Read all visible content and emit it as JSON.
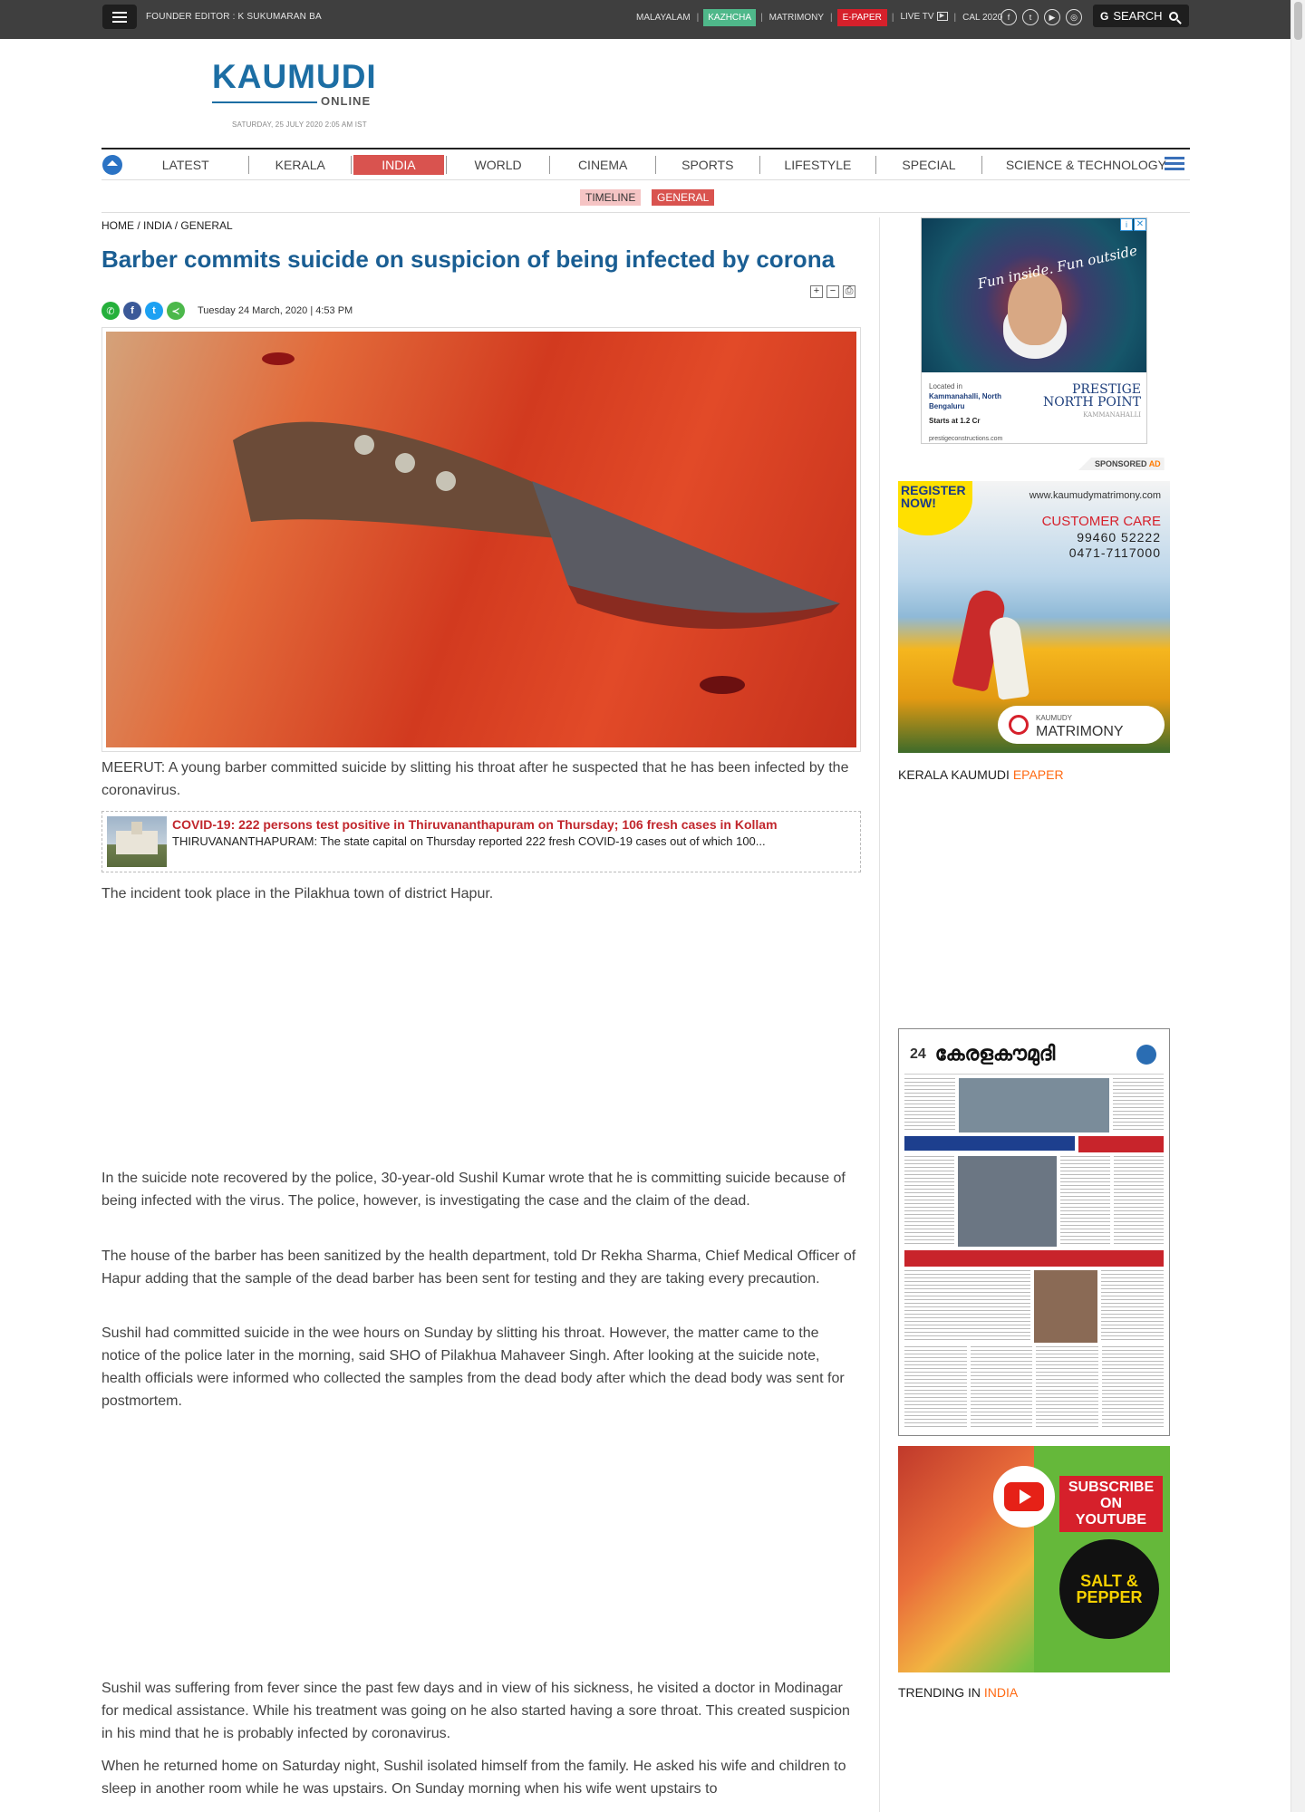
{
  "topbar": {
    "founder": "FOUNDER EDITOR : K SUKUMARAN BA",
    "links": [
      "MALAYALAM",
      "KAZHCHA",
      "MATRIMONY",
      "E-PAPER",
      "LIVE TV",
      "CAL 2020"
    ],
    "search_label": "SEARCH"
  },
  "logo": {
    "main": "KAUMUDI",
    "sub": "ONLINE"
  },
  "dateline": "SATURDAY, 25 JULY 2020 2:05 AM IST",
  "nav": {
    "items": [
      "LATEST",
      "KERALA",
      "INDIA",
      "WORLD",
      "CINEMA",
      "SPORTS",
      "LIFESTYLE",
      "SPECIAL",
      "SCIENCE & TECHNOLOGY"
    ],
    "active": "INDIA",
    "sub": [
      "TIMELINE",
      "GENERAL"
    ]
  },
  "article": {
    "breadcrumb": [
      "HOME",
      "INDIA",
      "GENERAL"
    ],
    "title": "Barber commits suicide on suspicion of being infected by corona",
    "date": "Tuesday 24 March, 2020 | 4:53 PM",
    "paragraphs": [
      "MEERUT: A young barber committed suicide by slitting his throat after he suspected that he has been infected by the coronavirus.",
      "The incident took place in the Pilakhua town of district Hapur.",
      "In the suicide note recovered by the police, 30-year-old Sushil Kumar wrote that he is committing suicide because of being infected with the virus. The police, however, is investigating the case and the claim of the dead.",
      "The house of the barber has been sanitized by the health department, told Dr Rekha Sharma, Chief Medical Officer of Hapur adding that the sample of the dead barber has been sent for testing and they are taking every precaution.",
      "Sushil had committed suicide in the wee hours on Sunday by slitting his throat. However, the matter came to the notice of the police later in the morning, said SHO of Pilakhua Mahaveer Singh. After looking at the suicide note, health officials were informed who collected the samples from the dead body after which the dead body was sent for postmortem.",
      "Sushil was suffering from fever since the past few days and in view of his sickness, he visited a doctor in Modinagar for medical assistance. While his treatment was going on he also started having a sore throat. This created suspicion in his mind that he is probably infected by coronavirus.",
      "When he returned home on Saturday night, Sushil isolated himself from the family. He asked his wife and children to sleep in another room while he was upstairs. On Sunday morning when his wife went upstairs to"
    ],
    "related": {
      "title": "COVID-19: 222 persons test positive in Thiruvananthapuram on Thursday; 106 fresh cases in Kollam",
      "desc": "THIRUVANANTHAPURAM: The state capital on Thursday reported 222 fresh COVID-19 cases out of which 100..."
    }
  },
  "sidebar": {
    "ad1": {
      "tagline": "Fun inside. Fun outside",
      "located": "Located in",
      "location": "Kammanahalli, North Bengaluru",
      "price": "Starts at 1.2 Cr",
      "url": "prestigeconstructions.com",
      "brand": "PRESTIGE NORTH POINT",
      "brand_sub": "KAMMANAHALLI"
    },
    "sponsored": "SPONSORED",
    "sponsored_ad": "AD",
    "ad2": {
      "register": "REGISTER NOW!",
      "url": "www.kaumudymatrimony.com",
      "care": "CUSTOMER CARE",
      "phone1": "99460 52222",
      "phone2": "0471-7117000",
      "brand_small": "KAUMUDY",
      "brand": "MATRIMONY"
    },
    "epaper_h": "KERALA KAUMUDI ",
    "epaper_acc": "EPAPER",
    "epaper_title": "കേരളകൗമുദി",
    "epaper_num": "24",
    "yt": {
      "subscribe": "SUBSCRIBE ON YOUTUBE",
      "salt": "SALT & PEPPER"
    },
    "trending_h": "TRENDING IN ",
    "trending_acc": "INDIA"
  }
}
